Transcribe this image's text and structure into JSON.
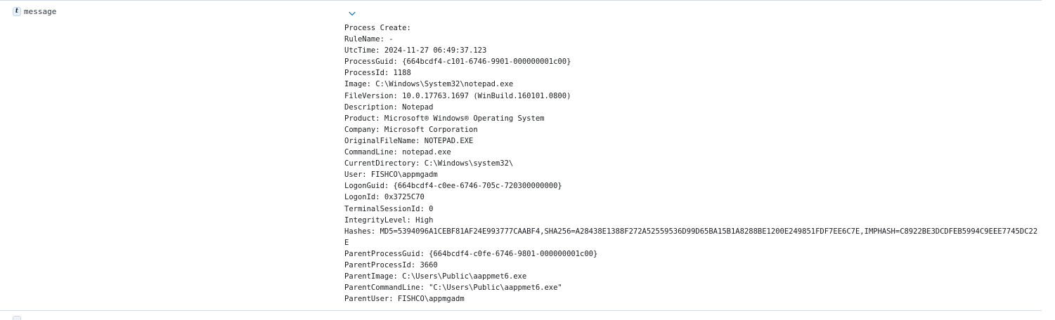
{
  "field": {
    "type_token": "t",
    "name": "message",
    "toggle_icon": "chevron-down-icon",
    "value_lines": [
      "Process Create:",
      "RuleName: -",
      "UtcTime: 2024-11-27 06:49:37.123",
      "ProcessGuid: {664bcdf4-c101-6746-9901-000000001c00}",
      "ProcessId: 1188",
      "Image: C:\\Windows\\System32\\notepad.exe",
      "FileVersion: 10.0.17763.1697 (WinBuild.160101.0800)",
      "Description: Notepad",
      "Product: Microsoft® Windows® Operating System",
      "Company: Microsoft Corporation",
      "OriginalFileName: NOTEPAD.EXE",
      "CommandLine: notepad.exe",
      "CurrentDirectory: C:\\Windows\\system32\\",
      "User: FISHCO\\appmgadm",
      "LogonGuid: {664bcdf4-c0ee-6746-705c-720300000000}",
      "LogonId: 0x3725C70",
      "TerminalSessionId: 0",
      "IntegrityLevel: High",
      "Hashes: MD5=5394096A1CEBF81AF24E993777CAABF4,SHA256=A28438E1388F272A52559536D99D65BA15B1A8288BE1200E249851FDF7EE6C7E,IMPHASH=C8922BE3DCDFEB5994C9EEE7745DC22E",
      "ParentProcessGuid: {664bcdf4-c0fe-6746-9801-000000001c00}",
      "ParentProcessId: 3660",
      "ParentImage: C:\\Users\\Public\\aappmet6.exe",
      "ParentCommandLine: \"C:\\Users\\Public\\aappmet6.exe\"",
      "ParentUser: FISHCO\\appmgadm"
    ]
  },
  "colors": {
    "border": "#d3dae6",
    "text": "#1a1c21",
    "accent": "#006bb8"
  }
}
